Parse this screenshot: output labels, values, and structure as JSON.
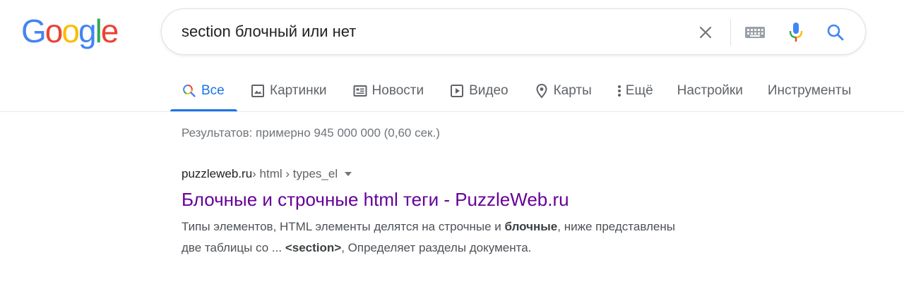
{
  "logo": {
    "letters": [
      "G",
      "o",
      "o",
      "g",
      "l",
      "e"
    ],
    "colors": [
      "#4285F4",
      "#EA4335",
      "#FBBC05",
      "#4285F4",
      "#34A853",
      "#EA4335"
    ]
  },
  "search": {
    "query": "section блочный или нет",
    "icons": [
      "clear-icon",
      "keyboard-icon",
      "microphone-icon",
      "search-icon"
    ]
  },
  "tabs": [
    {
      "label": "Все",
      "icon": "search-icon",
      "active": true
    },
    {
      "label": "Картинки",
      "icon": "image-icon"
    },
    {
      "label": "Новости",
      "icon": "news-icon"
    },
    {
      "label": "Видео",
      "icon": "play-icon"
    },
    {
      "label": "Карты",
      "icon": "map-pin-icon"
    },
    {
      "label": "Ещё",
      "icon": "more-vert-icon"
    },
    {
      "label": "Настройки"
    },
    {
      "label": "Инструменты"
    }
  ],
  "stats": "Результатов: примерно 945 000 000 (0,60 сек.)",
  "result": {
    "site": "puzzleweb.ru",
    "breadcrumbs": " › html › types_el",
    "title": "Блочные и строчные html теги - PuzzleWeb.ru",
    "snippet_line1_a": "Типы элементов, HTML элементы делятся на строчные и ",
    "snippet_line1_bold": "блочные",
    "snippet_line1_b": ", ниже представлены",
    "snippet_line2_a": "две таблицы со ... ",
    "snippet_line2_bold": "<section>",
    "snippet_line2_b": ", Определяет разделы документа.",
    "colors": {
      "title": "#660099",
      "cite": "#202124",
      "snippet": "#4d5156"
    }
  },
  "accent": "#1a73e8"
}
